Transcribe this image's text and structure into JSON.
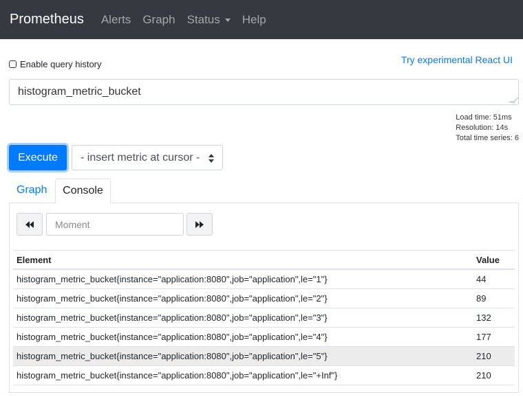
{
  "navbar": {
    "brand": "Prometheus",
    "items": [
      {
        "label": "Alerts"
      },
      {
        "label": "Graph"
      },
      {
        "label": "Status"
      },
      {
        "label": "Help"
      }
    ]
  },
  "history": {
    "label": "Enable query history"
  },
  "react_link": "Try experimental React UI",
  "query": {
    "value": "histogram_metric_bucket"
  },
  "stats": {
    "load_time": "Load time: 51ms",
    "resolution": "Resolution: 14s",
    "total_series": "Total time series: 6"
  },
  "execute_label": "Execute",
  "metric_select": "- insert metric at cursor -",
  "tabs": [
    {
      "label": "Graph"
    },
    {
      "label": "Console"
    }
  ],
  "moment": {
    "placeholder": "Moment"
  },
  "table": {
    "columns": [
      "Element",
      "Value"
    ],
    "rows": [
      {
        "element": "histogram_metric_bucket{instance=\"application:8080\",job=\"application\",le=\"1\"}",
        "value": "44"
      },
      {
        "element": "histogram_metric_bucket{instance=\"application:8080\",job=\"application\",le=\"2\"}",
        "value": "89"
      },
      {
        "element": "histogram_metric_bucket{instance=\"application:8080\",job=\"application\",le=\"3\"}",
        "value": "132"
      },
      {
        "element": "histogram_metric_bucket{instance=\"application:8080\",job=\"application\",le=\"4\"}",
        "value": "177"
      },
      {
        "element": "histogram_metric_bucket{instance=\"application:8080\",job=\"application\",le=\"5\"}",
        "value": "210"
      },
      {
        "element": "histogram_metric_bucket{instance=\"application:8080\",job=\"application\",le=\"+Inf\"}",
        "value": "210"
      }
    ]
  },
  "colors": {
    "navbar_bg": "#343a40",
    "primary": "#007bff",
    "highlight_row": "#ececec"
  }
}
